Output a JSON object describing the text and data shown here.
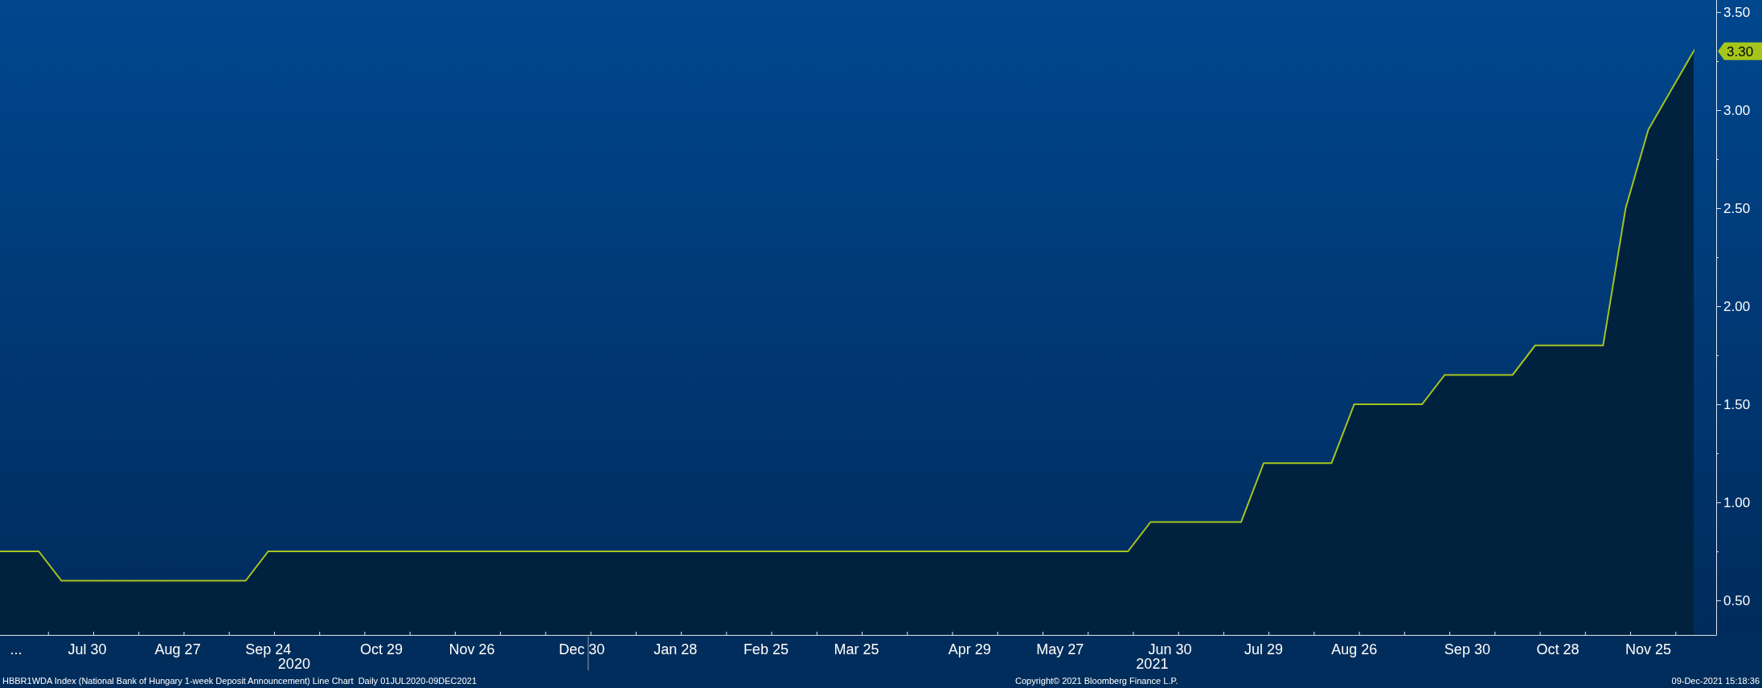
{
  "chart": {
    "chart_data": {
      "type": "area",
      "x": [
        "2020-07-03",
        "2020-07-15",
        "2020-07-22",
        "2020-09-17",
        "2020-09-24",
        "2021-06-17",
        "2021-06-24",
        "2021-07-22",
        "2021-07-29",
        "2021-08-19",
        "2021-08-26",
        "2021-09-16",
        "2021-09-23",
        "2021-10-14",
        "2021-10-21",
        "2021-11-11",
        "2021-11-18",
        "2021-11-25",
        "2021-12-09"
      ],
      "series": [
        {
          "color": "#a6c51c",
          "values": [
            0.75,
            0.75,
            0.6,
            0.6,
            0.75,
            0.75,
            0.9,
            0.9,
            1.2,
            1.2,
            1.5,
            1.5,
            1.65,
            1.65,
            1.8,
            1.8,
            2.5,
            2.9,
            3.3
          ]
        }
      ],
      "xlim": [
        "2020-07-03",
        "2021-12-16"
      ],
      "ylim": [
        0.324,
        3.561
      ],
      "xticks": [
        {
          "value": "2020-07-08",
          "label": "..."
        },
        {
          "value": "2020-07-30",
          "label": "Jul 30"
        },
        {
          "value": "2020-08-27",
          "label": "Aug 27"
        },
        {
          "value": "2020-09-24",
          "label": "Sep 24"
        },
        {
          "value": "2020-10-29",
          "label": "Oct 29"
        },
        {
          "value": "2020-11-26",
          "label": "Nov 26"
        },
        {
          "value": "2020-12-30",
          "label": "Dec 30"
        },
        {
          "value": "2021-01-28",
          "label": "Jan 28"
        },
        {
          "value": "2021-02-25",
          "label": "Feb 25"
        },
        {
          "value": "2021-03-25",
          "label": "Mar 25"
        },
        {
          "value": "2021-04-29",
          "label": "Apr 29"
        },
        {
          "value": "2021-05-27",
          "label": "May 27"
        },
        {
          "value": "2021-06-30",
          "label": "Jun 30"
        },
        {
          "value": "2021-07-29",
          "label": "Jul 29"
        },
        {
          "value": "2021-08-26",
          "label": "Aug 26"
        },
        {
          "value": "2021-09-30",
          "label": "Sep 30"
        },
        {
          "value": "2021-10-28",
          "label": "Oct 28"
        },
        {
          "value": "2021-11-25",
          "label": "Nov 25"
        }
      ],
      "yticks": [
        {
          "value": 0.5,
          "label": "0.50"
        },
        {
          "value": 1,
          "label": "1.00"
        },
        {
          "value": 1.5,
          "label": "1.50"
        },
        {
          "value": 2,
          "label": "2.00"
        },
        {
          "value": 2.5,
          "label": "2.50"
        },
        {
          "value": 3,
          "label": "3.00"
        },
        {
          "value": 3.5,
          "label": "3.50"
        }
      ],
      "annotations": [
        "3.30"
      ]
    },
    "year_labels": [
      "2020",
      "2021"
    ]
  },
  "footer": {
    "description": "HBBR1WDA Index (National Bank of Hungary 1-week Deposit Announcement) Line Chart  Daily 01JUL2020-09DEC2021",
    "copyright": "Copyright© 2021 Bloomberg Finance L.P.",
    "timestamp": "09-Dec-2021 15:18:36"
  }
}
